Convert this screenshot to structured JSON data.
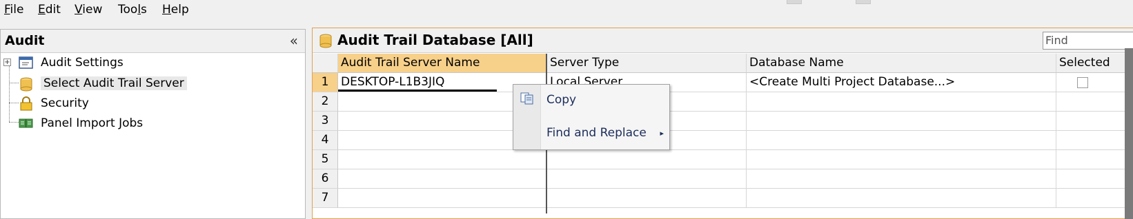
{
  "menu": {
    "items": [
      {
        "accel": "F",
        "rest": "ile"
      },
      {
        "accel": "E",
        "rest": "dit"
      },
      {
        "accel": "V",
        "rest": "iew"
      },
      {
        "pre": "Too",
        "accel": "l",
        "rest": "s"
      },
      {
        "accel": "H",
        "rest": "elp"
      }
    ]
  },
  "left": {
    "title": "Audit",
    "collapse": "«",
    "tree": [
      {
        "label": "Audit Settings",
        "icon": "settings-window-icon"
      },
      {
        "label": "Select Audit Trail Server",
        "icon": "database-icon"
      },
      {
        "label": "Security",
        "icon": "lock-icon"
      },
      {
        "label": "Panel Import Jobs",
        "icon": "panel-jobs-icon"
      }
    ]
  },
  "right": {
    "title": "Audit Trail Database [All]",
    "find_placeholder": "Find",
    "columns": [
      "Audit Trail Server Name",
      "Server Type",
      "Database Name",
      "Selected"
    ],
    "rows": [
      {
        "num": "1",
        "server": "DESKTOP-L1B3JIQ",
        "type": "Local Server",
        "db": "<Create Multi Project Database...>"
      },
      {
        "num": "2"
      },
      {
        "num": "3"
      },
      {
        "num": "4"
      },
      {
        "num": "5"
      },
      {
        "num": "6"
      },
      {
        "num": "7"
      }
    ]
  },
  "context_menu": {
    "items": [
      {
        "label": "Copy"
      },
      {
        "label": "Find and Replace"
      }
    ],
    "submenu_arrow": "▸"
  },
  "colors": {
    "selected_header": "#f7d08a",
    "panel_border": "#e0a050"
  }
}
